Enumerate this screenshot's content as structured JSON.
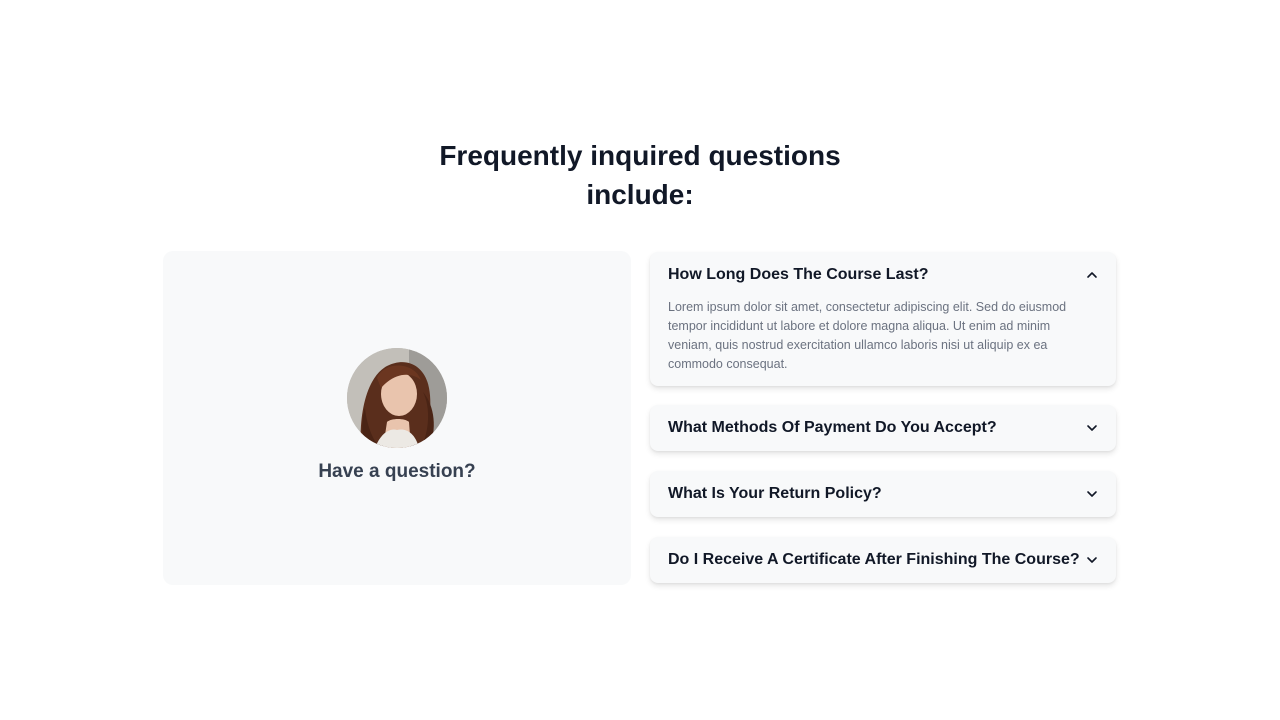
{
  "section": {
    "title_line1": "Frequently inquired questions",
    "title_line2": "include:"
  },
  "contact_card": {
    "caption": "Have a question?"
  },
  "faq": [
    {
      "question": "How Long Does The Course Last?",
      "answer": "Lorem ipsum dolor sit amet, consectetur adipiscing elit. Sed do eiusmod tempor incididunt ut labore et dolore magna aliqua. Ut enim ad minim veniam, quis nostrud exercitation ullamco laboris nisi ut aliquip ex ea commodo consequat.",
      "expanded": true,
      "icon": "chevron-up-icon"
    },
    {
      "question": "What Methods Of Payment Do You Accept?",
      "expanded": false,
      "icon": "chevron-down-icon"
    },
    {
      "question": "What Is Your Return Policy?",
      "expanded": false,
      "icon": "chevron-down-icon"
    },
    {
      "question": "Do I Receive A Certificate After Finishing The Course?",
      "expanded": false,
      "icon": "chevron-down-icon"
    }
  ],
  "colors": {
    "card_background": "#f8f9fa",
    "heading": "#111827",
    "body_text": "#6b7280"
  }
}
